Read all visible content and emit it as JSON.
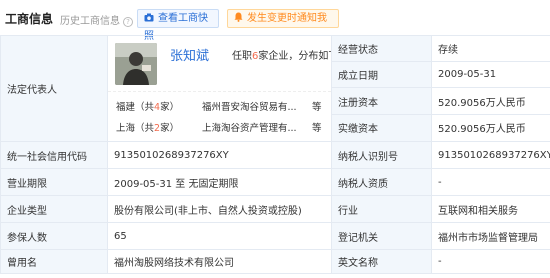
{
  "header": {
    "title": "工商信息",
    "history_label": "历史工商信息",
    "history_help": "?",
    "snapshot_button": "查看工商快照",
    "notify_button": "发生变更时通知我"
  },
  "legal_rep": {
    "label": "法定代表人",
    "name": "张知斌",
    "role_prefix": "任职",
    "role_count": "6",
    "role_suffix": "家企业，分布如下",
    "regions": [
      {
        "name": "福建（共",
        "count": "4",
        "suffix": "家）",
        "company": "福州晋安淘谷贸易有...",
        "etc": "等"
      },
      {
        "name": "上海（共",
        "count": "2",
        "suffix": "家）",
        "company": "上海淘谷资产管理有...",
        "etc": "等"
      }
    ]
  },
  "right_rows": [
    {
      "label": "经营状态",
      "value": "存续"
    },
    {
      "label": "成立日期",
      "value": "2009-05-31"
    },
    {
      "label": "注册资本",
      "value": "520.9056万人民币"
    },
    {
      "label": "实缴资本",
      "value": "520.9056万人民币"
    }
  ],
  "rows": [
    {
      "l1": "统一社会信用代码",
      "v1": "913501026893727​6XY",
      "l2": "纳税人识别号",
      "v2": "9135010268937276XY"
    },
    {
      "l1": "营业期限",
      "v1": "2009-05-31 至 无固定期限",
      "l2": "纳税人资质",
      "v2": "-"
    },
    {
      "l1": "企业类型",
      "v1": "股份有限公司(非上市、自然人投资或控股)",
      "l2": "行业",
      "v2": "互联网和相关服务"
    },
    {
      "l1": "参保人数",
      "v1": "65",
      "l2": "登记机关",
      "v2": "福州市市场监督管理局"
    },
    {
      "l1": "曾用名",
      "v1": "福州淘股网络技术有限公司",
      "l2": "英文名称",
      "v2": "-"
    }
  ]
}
